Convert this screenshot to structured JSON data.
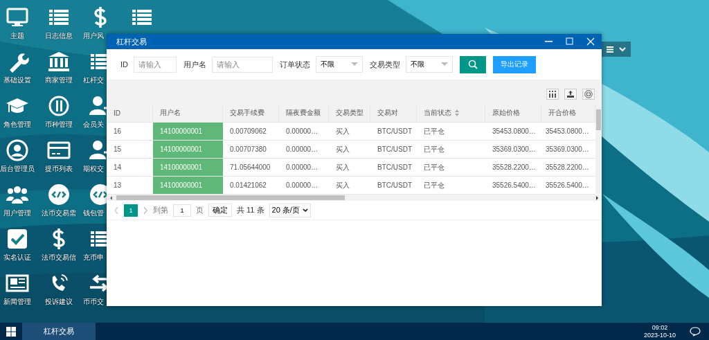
{
  "desktop": {
    "icons": [
      {
        "label": "主题"
      },
      {
        "label": "基础设置"
      },
      {
        "label": "角色管理"
      },
      {
        "label": "后台管理员"
      },
      {
        "label": "用户管理"
      },
      {
        "label": "实名认证"
      },
      {
        "label": "新闻管理"
      },
      {
        "label": "日志信息"
      },
      {
        "label": "商家管理"
      },
      {
        "label": "币种管理"
      },
      {
        "label": "提币列表"
      },
      {
        "label": "法币交易需"
      },
      {
        "label": "法币交易信"
      },
      {
        "label": "投诉建议"
      },
      {
        "label": "用户风"
      },
      {
        "label": "杠杆交"
      },
      {
        "label": "会员关"
      },
      {
        "label": "期权交"
      },
      {
        "label": "钱包管"
      },
      {
        "label": "充币申"
      },
      {
        "label": "币币交"
      }
    ]
  },
  "window": {
    "title": "杠杆交易",
    "filters": [
      {
        "kind": "input",
        "label": "ID",
        "placeholder": "请输入"
      },
      {
        "kind": "input",
        "label": "用户名",
        "placeholder": "请输入"
      },
      {
        "kind": "select",
        "label": "订单状态",
        "value": "不限"
      },
      {
        "kind": "select",
        "label": "交易类型",
        "value": "不限"
      }
    ],
    "export_button": "导出记录",
    "table": {
      "columns": [
        {
          "label": "ID",
          "sortable": false,
          "highlight": false
        },
        {
          "label": "用户名",
          "sortable": false,
          "highlight": true
        },
        {
          "label": "交易手续费",
          "sortable": false,
          "highlight": false
        },
        {
          "label": "隔夜费金额",
          "sortable": false,
          "highlight": false
        },
        {
          "label": "交易类型",
          "sortable": false,
          "highlight": false
        },
        {
          "label": "交易对",
          "sortable": false,
          "highlight": false
        },
        {
          "label": "当前状态",
          "sortable": true,
          "highlight": false
        },
        {
          "label": "原始价格",
          "sortable": false,
          "highlight": false
        },
        {
          "label": "开合价格",
          "sortable": false,
          "highlight": false
        }
      ],
      "rows": [
        [
          "16",
          "14100000001",
          "0.00709062",
          "0.00000…",
          "买入",
          "BTC/USDT",
          "已平仓",
          "35453.0800…",
          "35453.0800…"
        ],
        [
          "15",
          "14100000001",
          "0.00707380",
          "0.00000…",
          "买入",
          "BTC/USDT",
          "已平仓",
          "35369.0300…",
          "35369.0300…"
        ],
        [
          "14",
          "14100000001",
          "71.05644000",
          "0.00000…",
          "买入",
          "BTC/USDT",
          "已平仓",
          "35528.2200…",
          "35528.2200…"
        ],
        [
          "13",
          "14100000001",
          "0.01421062",
          "0.00000…",
          "买入",
          "BTC/USDT",
          "已平仓",
          "35526.5400…",
          "35526.5400…"
        ]
      ]
    },
    "pagination": {
      "pages": [
        {
          "label": "1",
          "selected": true
        }
      ],
      "goto_label": "到第",
      "page_input": "1",
      "page_unit": "页",
      "confirm": "确定",
      "total": "共 11 条",
      "page_size": "20 条/页"
    }
  },
  "taskbar": {
    "tasks": [
      {
        "label": "杠杆交易",
        "selected": true
      }
    ],
    "time": "09:02",
    "date": "2023-10-10"
  }
}
